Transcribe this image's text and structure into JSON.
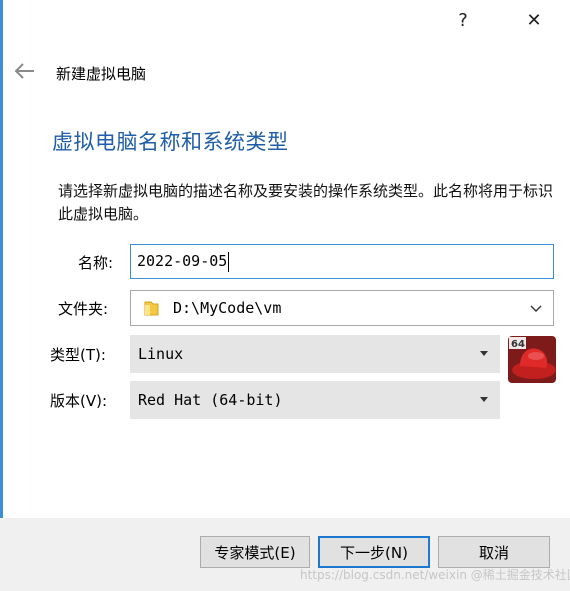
{
  "window": {
    "help_glyph": "?",
    "close_glyph": "✕",
    "title": "新建虚拟电脑"
  },
  "page": {
    "heading": "虚拟电脑名称和系统类型",
    "description": "请选择新虚拟电脑的描述名称及要安装的操作系统类型。此名称将用于标识此虚拟电脑。"
  },
  "form": {
    "name": {
      "label": "名称:",
      "value": "2022-09-05"
    },
    "folder": {
      "label": "文件夹:",
      "value": "D:\\MyCode\\vm"
    },
    "type": {
      "label": "类型(T):",
      "value": "Linux"
    },
    "version": {
      "label": "版本(V):",
      "value": "Red Hat (64-bit)"
    },
    "os_badge": "64"
  },
  "footer": {
    "expert_button": "专家模式(E)",
    "next_button": "下一步(N)",
    "cancel_button": "取消"
  },
  "watermark": "https://blog.csdn.net/weixin @稀土掘金技术社区",
  "colors": {
    "accent": "#3c8fd6",
    "heading": "#1f5ea8",
    "footer_bg": "#f0f0f0"
  }
}
